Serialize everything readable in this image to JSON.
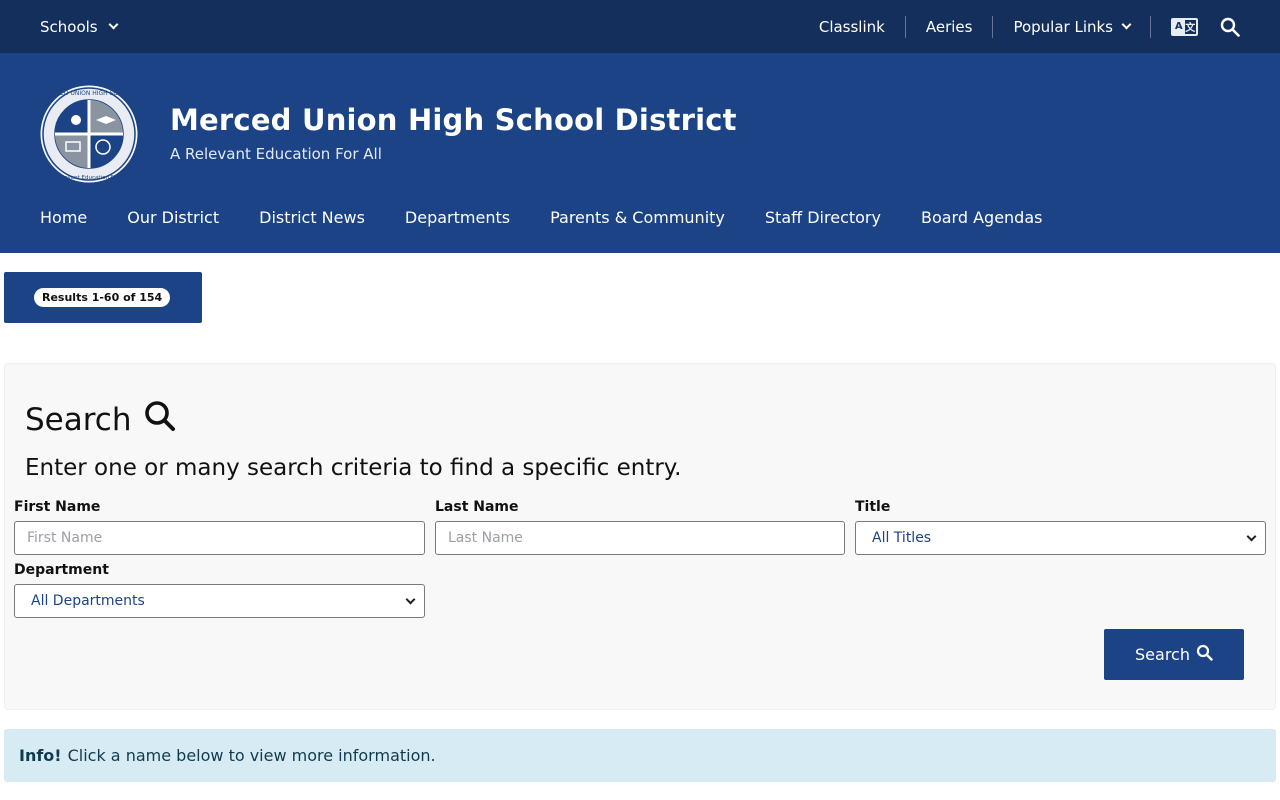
{
  "topbar": {
    "schools_label": "Schools",
    "links": [
      "Classlink",
      "Aeries",
      "Popular Links"
    ]
  },
  "header": {
    "title": "Merced Union High School District",
    "tagline": "A Relevant Education For All",
    "logo_ring_text": "MERCED UNION HIGH SCHOOL DISTRICT",
    "logo_bottom_text": "A Relevant Education For All"
  },
  "nav": {
    "items": [
      "Home",
      "Our District",
      "District News",
      "Departments",
      "Parents & Community",
      "Staff Directory",
      "Board Agendas"
    ]
  },
  "results": {
    "label": "Results 1-60 of 154"
  },
  "search": {
    "title": "Search",
    "subtitle": "Enter one or many search criteria to find a specific entry.",
    "first_name_label": "First Name",
    "first_name_placeholder": "First Name",
    "last_name_label": "Last Name",
    "last_name_placeholder": "Last Name",
    "title_label": "Title",
    "title_value": "All Titles",
    "department_label": "Department",
    "department_value": "All Departments",
    "button_label": "Search"
  },
  "info": {
    "strong": "Info!",
    "text": "Click a name below to view more information."
  },
  "colors": {
    "topbar": "#152f5c",
    "header": "#1c4386",
    "info_bg": "#d7ebf4"
  }
}
